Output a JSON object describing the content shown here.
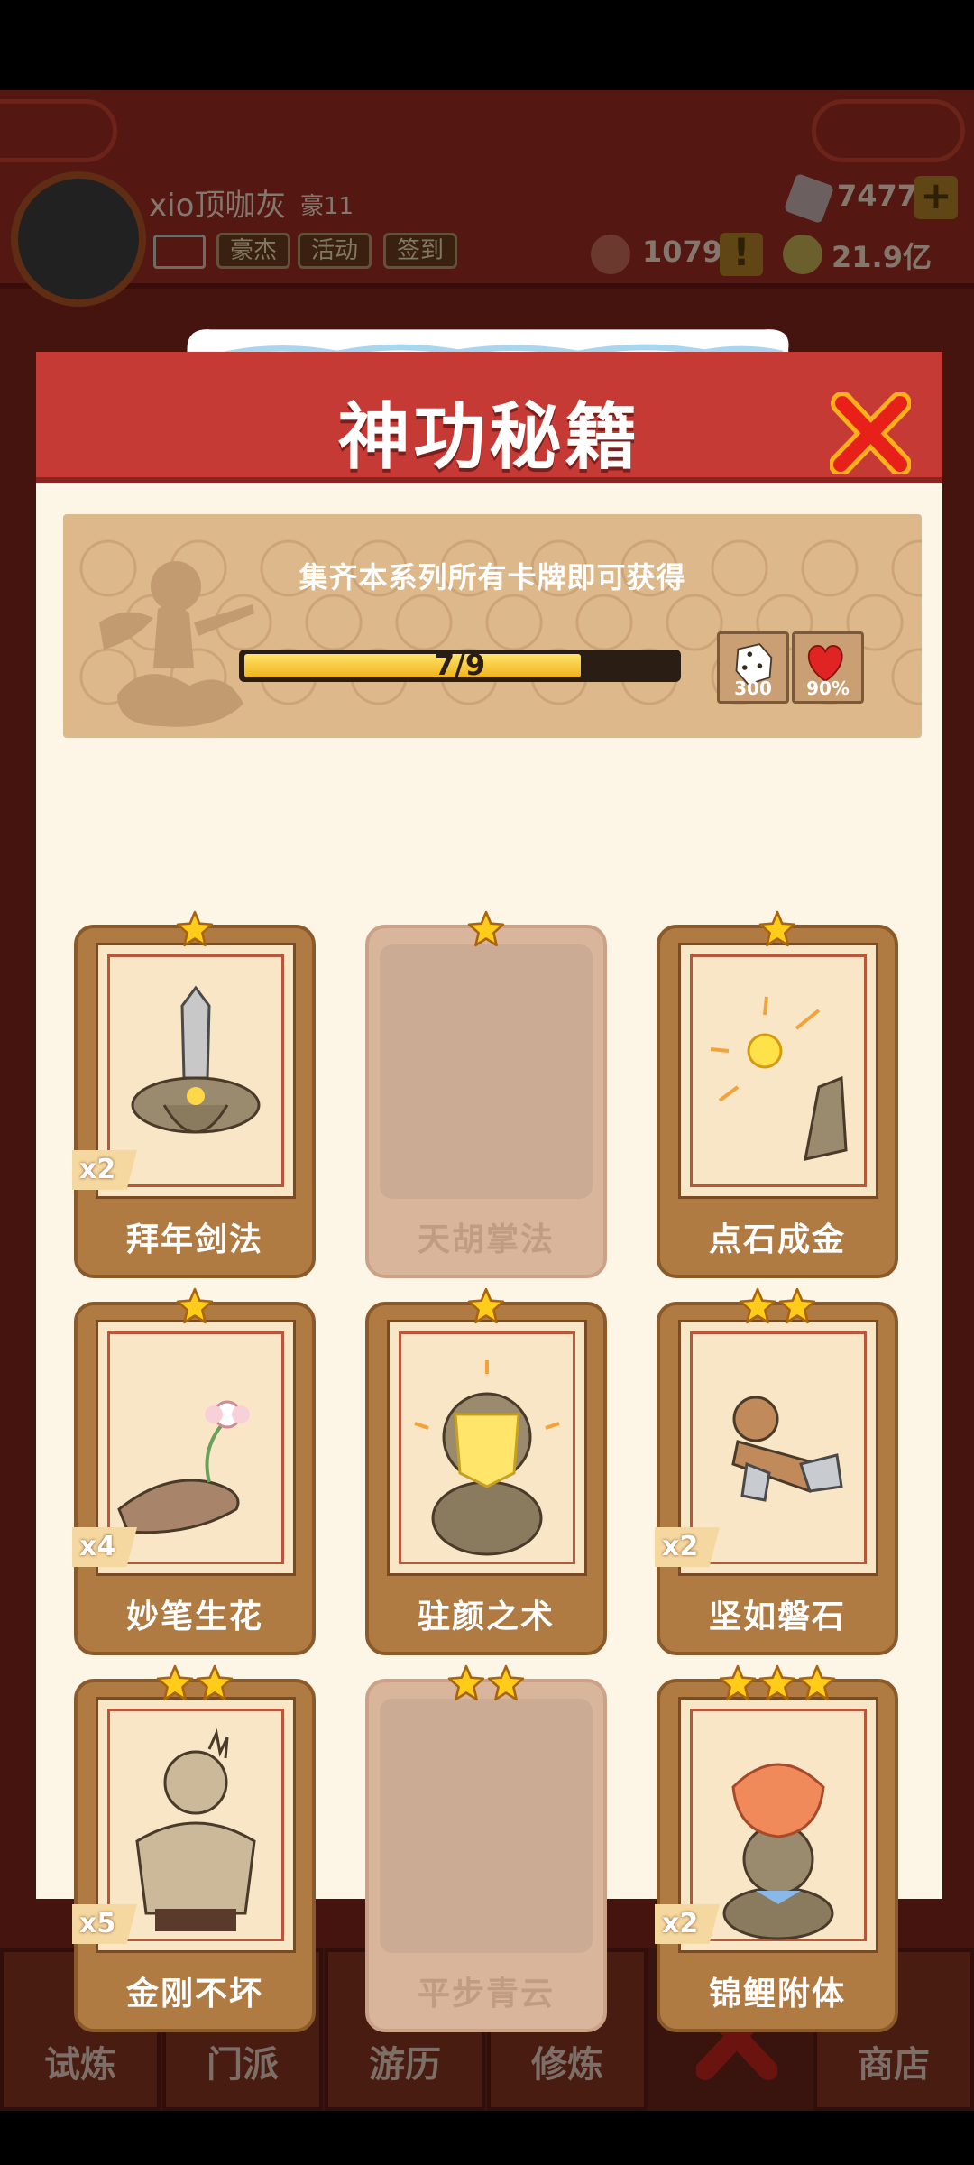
{
  "background": {
    "player_name": "xio顶咖灰",
    "player_level": "豪11",
    "top_buttons": [
      "豪杰",
      "活动",
      "签到"
    ],
    "gems": "7477",
    "tokens": "1079",
    "gold": "21.9亿",
    "alert": "!",
    "plus": "+",
    "nav": [
      "试炼",
      "门派",
      "游历",
      "修炼",
      "商店"
    ]
  },
  "modal": {
    "title": "神功秘籍",
    "banner_text": "集齐本系列所有卡牌即可获得",
    "progress_text": "7/9",
    "progress_value": 0.78,
    "rewards": [
      {
        "icon": "dice-icon",
        "label": "300"
      },
      {
        "icon": "heart-icon",
        "label": "90%"
      }
    ]
  },
  "cards": [
    {
      "name": "拜年剑法",
      "stars": 1,
      "count": "x2",
      "locked": false,
      "art": "sword"
    },
    {
      "name": "天胡掌法",
      "stars": 1,
      "count": "",
      "locked": true,
      "art": ""
    },
    {
      "name": "点石成金",
      "stars": 1,
      "count": "",
      "locked": false,
      "art": "gold-finger"
    },
    {
      "name": "妙笔生花",
      "stars": 1,
      "count": "x4",
      "locked": false,
      "art": "flower"
    },
    {
      "name": "驻颜之术",
      "stars": 1,
      "count": "",
      "locked": false,
      "art": "mask"
    },
    {
      "name": "坚如磐石",
      "stars": 2,
      "count": "x2",
      "locked": false,
      "art": "rock"
    },
    {
      "name": "金刚不坏",
      "stars": 2,
      "count": "x5",
      "locked": false,
      "art": "muscle"
    },
    {
      "name": "平步青云",
      "stars": 2,
      "count": "",
      "locked": true,
      "art": ""
    },
    {
      "name": "锦鲤附体",
      "stars": 3,
      "count": "x2",
      "locked": false,
      "art": "koi"
    }
  ],
  "colors": {
    "header_red": "#c63a35",
    "progress_yellow": "#f0b31a",
    "card_brown": "#b07a43",
    "star_gold": "#ffcc1a"
  }
}
